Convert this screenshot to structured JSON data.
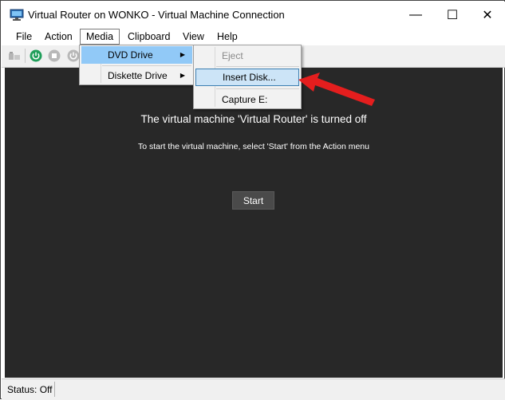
{
  "window": {
    "title": "Virtual Router on WONKO - Virtual Machine Connection",
    "controls": {
      "minimize": "—",
      "maximize": "☐",
      "close": "✕"
    }
  },
  "menubar": {
    "items": [
      {
        "label": "File"
      },
      {
        "label": "Action"
      },
      {
        "label": "Media"
      },
      {
        "label": "Clipboard"
      },
      {
        "label": "View"
      },
      {
        "label": "Help"
      }
    ]
  },
  "media_menu": {
    "items": [
      {
        "label": "DVD Drive",
        "submenu_arrow": "▶"
      },
      {
        "label": "Diskette Drive",
        "submenu_arrow": "▶"
      }
    ]
  },
  "dvd_menu": {
    "items": [
      {
        "label": "Eject",
        "enabled": false
      },
      {
        "label": "Insert Disk...",
        "enabled": true
      },
      {
        "label": "Capture E:",
        "enabled": true
      }
    ]
  },
  "vm": {
    "status_message": "The virtual machine 'Virtual Router' is turned off",
    "instruction": "To start the virtual machine, select 'Start' from the Action menu",
    "start_label": "Start"
  },
  "statusbar": {
    "text": "Status: Off"
  },
  "colors": {
    "vm_background": "#282828",
    "highlight": "#91c9f7",
    "annotation_arrow": "#e41e1e"
  }
}
